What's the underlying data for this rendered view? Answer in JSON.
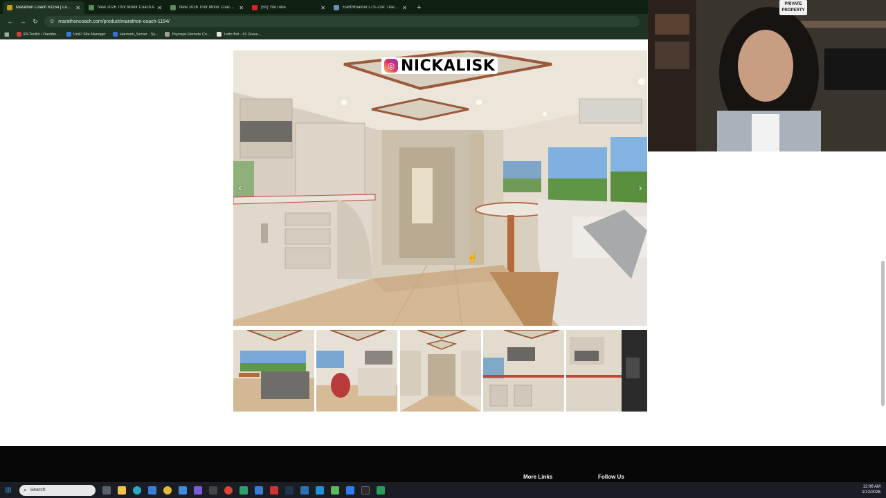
{
  "browser": {
    "tabs": [
      {
        "title": "Marathon Coach #1154 | Luxury",
        "active": true,
        "favicon_color": "#c8a020"
      },
      {
        "title": "New 2026 Thor Motor Coach A",
        "active": false,
        "favicon_color": "#5a8c5a"
      },
      {
        "title": "New 2026 Thor Motor Coach R",
        "active": false,
        "favicon_color": "#5a8c5a"
      },
      {
        "title": "(50) YouTube",
        "active": false,
        "favicon_color": "#e02020"
      },
      {
        "title": "EarthRoamer LTS-234: Travel Ch",
        "active": false,
        "favicon_color": "#6a8fb0"
      }
    ],
    "url": "marathoncoach.com/product/marathon-coach-1154/",
    "bookmarks": [
      {
        "label": "IRLToolkit • Dashbo...",
        "color": "#d23c3c"
      },
      {
        "label": "UniFi Site Manager",
        "color": "#2f7de1"
      },
      {
        "label": "Harrison_Server - Sy...",
        "color": "#3a6fd8"
      },
      {
        "label": "Psynaps Remote Co...",
        "color": "#9aa19a"
      },
      {
        "label": "Lotto Bot - #1 Givea...",
        "color": "#e6e6e6"
      }
    ]
  },
  "gallery": {
    "prev_icon": "chevron-left-icon",
    "next_icon": "chevron-right-icon"
  },
  "footer": {
    "brand_handle": "NICKALISK",
    "more_links": "More Links",
    "follow_us": "Follow Us"
  },
  "webcam": {
    "sign_text": "PRIVATE PROPERTY"
  },
  "taskbar": {
    "search_placeholder": "Search",
    "time": "12:06 AM",
    "date": "1/12/2026"
  }
}
